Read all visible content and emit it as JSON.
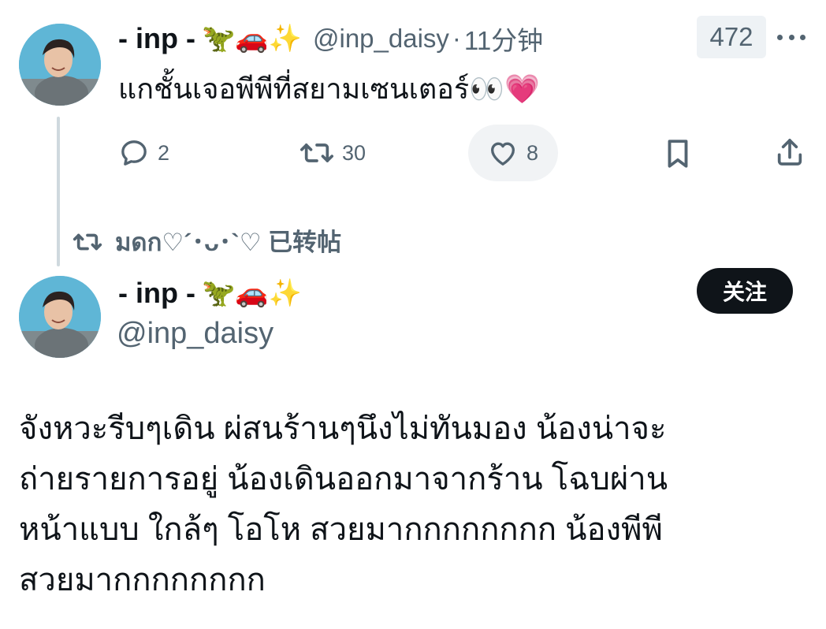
{
  "tweet1": {
    "display_name": "- inp -",
    "name_emojis": "🦖🚗✨",
    "handle": "@inp_daisy",
    "separator": "·",
    "time": "11分钟",
    "view_count": "472",
    "text": "แกชั้นเจอพีพีที่สยามเซนเตอร์👀💗",
    "actions": {
      "reply_count": "2",
      "retweet_count": "30",
      "like_count": "8"
    }
  },
  "retweet_notice": {
    "text": "มดก♡´･ᴗ･`♡ 已转帖"
  },
  "tweet2": {
    "display_name": "- inp -",
    "name_emojis": "🦖🚗✨",
    "handle": "@inp_daisy",
    "follow_label": "关注",
    "text_lines": [
      "จังหวะรีบๆเดิน ผ่สนร้านๆนึงไม่ทันมอง น้องน่าจะ",
      "ถ่ายรายการอยู่ น้องเดินออกมาจากร้าน โฉบผ่าน",
      "หน้าแบบ ใกล้ๆ  โอโห สวยมากกกกกกกก น้องพีพี",
      "สวยมากกกกกกกก"
    ]
  },
  "colors": {
    "text_primary": "#0f1419",
    "text_secondary": "#536471",
    "thread_line": "#cfd9de",
    "follow_bg": "#0f1419",
    "avatar_bg": "#63b8d8"
  },
  "icons": {
    "more": "more-dots-icon",
    "reply": "reply-icon",
    "retweet": "retweet-icon",
    "like": "heart-icon",
    "bookmark": "bookmark-icon",
    "share": "share-icon"
  }
}
